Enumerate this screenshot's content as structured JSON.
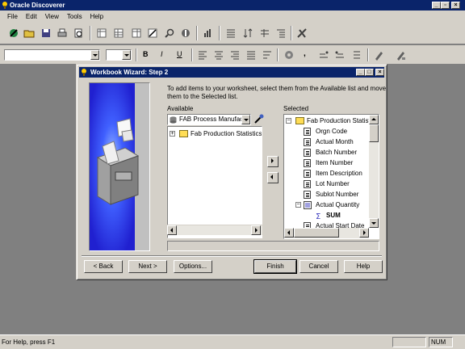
{
  "app": {
    "title": "Oracle Discoverer",
    "menu": [
      "File",
      "Edit",
      "View",
      "Tools",
      "Help"
    ]
  },
  "toolbar2": {
    "bold": "B",
    "italic": "I",
    "underline": "U",
    "comma": ","
  },
  "status": {
    "help_text": "For Help, press F1",
    "num": "NUM"
  },
  "wizard": {
    "title": "Workbook Wizard: Step 2",
    "instructions": "To add items to your worksheet, select them from the Available list and move them to the Selected list.",
    "available_label": "Available",
    "selected_label": "Selected",
    "business_area": "FAB Process Manufact",
    "available_items": [
      "Fab Production Statistics"
    ],
    "selected_folder": "Fab Production Statisti",
    "selected_items": [
      "Orgn Code",
      "Actual Month",
      "Batch Number",
      "Item Number",
      "Item Description",
      "Lot Number",
      "Sublot Number",
      "Actual Quantity",
      "SUM",
      "Actual Start Date"
    ],
    "buttons": {
      "back": "< Back",
      "next": "Next >",
      "options": "Options...",
      "finish": "Finish",
      "cancel": "Cancel",
      "help": "Help"
    }
  },
  "colors": {
    "titlebar": "#0a246a",
    "face": "#d4d0c8",
    "desktop": "#808080"
  }
}
